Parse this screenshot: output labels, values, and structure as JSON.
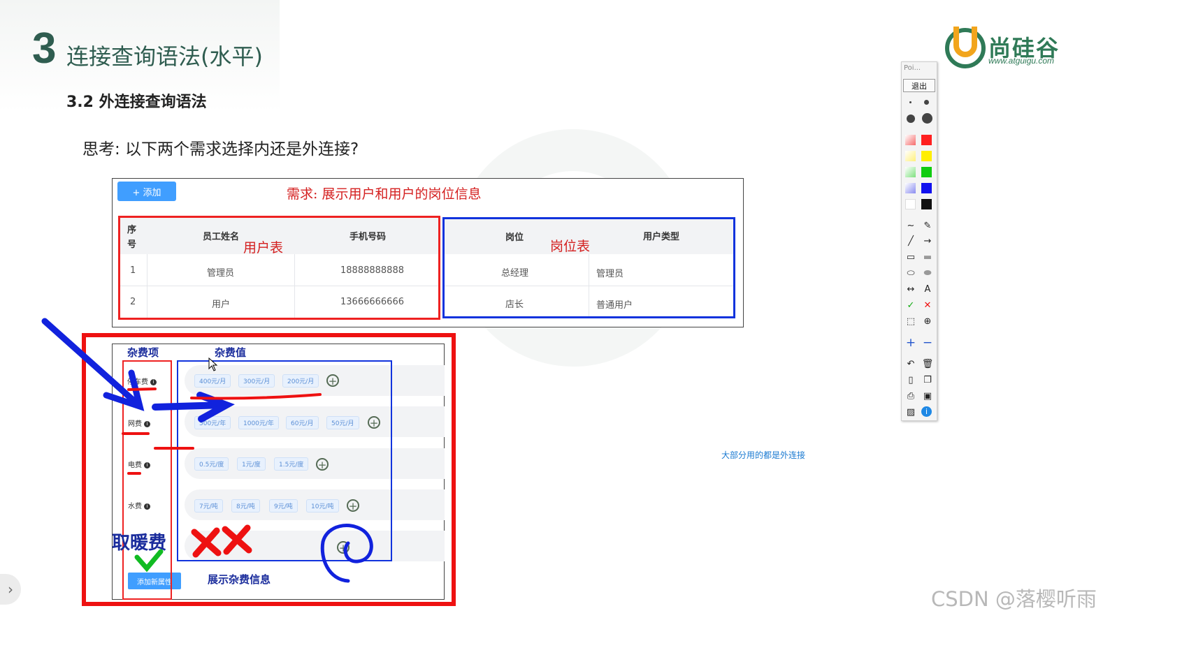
{
  "slide": {
    "number": "3",
    "title": "连接查询语法(水平)",
    "subtitle": "3.2 外连接查询语法",
    "question": "思考: 以下两个需求选择内还是外连接?",
    "note": "大部分用的都是外连接"
  },
  "logo": {
    "text": "尚硅谷",
    "url": "www.atguigu.com"
  },
  "table_panel": {
    "add_button": "+ 添加",
    "requirement": "需求: 展示用户和用户的岗位信息",
    "user_table_tag": "用户表",
    "job_table_tag": "岗位表",
    "columns": [
      "序号",
      "员工姓名",
      "手机号码",
      "岗位",
      "用户类型"
    ],
    "seq_header_top": "序",
    "seq_header_bottom": "号",
    "rows": [
      {
        "seq": "1",
        "name": "管理员",
        "phone": "18888888888",
        "job": "总经理",
        "type": "管理员"
      },
      {
        "seq": "2",
        "name": "用户",
        "phone": "13666666666",
        "job": "店长",
        "type": "普通用户"
      }
    ]
  },
  "fee_panel": {
    "item_header": "杂费项",
    "value_header": "杂费值",
    "fees": [
      {
        "label": "停车费",
        "values": [
          "400元/月",
          "300元/月",
          "200元/月"
        ]
      },
      {
        "label": "网费",
        "values": [
          "500元/年",
          "1000元/年",
          "60元/月",
          "50元/月"
        ]
      },
      {
        "label": "电费",
        "values": [
          "0.5元/度",
          "1元/度",
          "1.5元/度"
        ]
      },
      {
        "label": "水费",
        "values": [
          "7元/吨",
          "8元/吨",
          "9元/吨",
          "10元/吨"
        ]
      }
    ],
    "heating_label": "取暖费",
    "add_attr_button": "添加新属性",
    "show_text": "展示杂费信息"
  },
  "toolbar": {
    "title": "Poi...",
    "exit": "退出",
    "colors": [
      "#f66b6b",
      "#ff2020",
      "#fff07a",
      "#ffee00",
      "#7ee07e",
      "#11cc11",
      "#8a8cf0",
      "#1111ee",
      "#ffffff",
      "#111111"
    ]
  },
  "watermark": "CSDN @落樱听雨",
  "colors": {
    "accent_green": "#2f5d50",
    "annot_red": "#ee1111",
    "annot_blue": "#1133dd",
    "button_blue": "#409eff"
  }
}
